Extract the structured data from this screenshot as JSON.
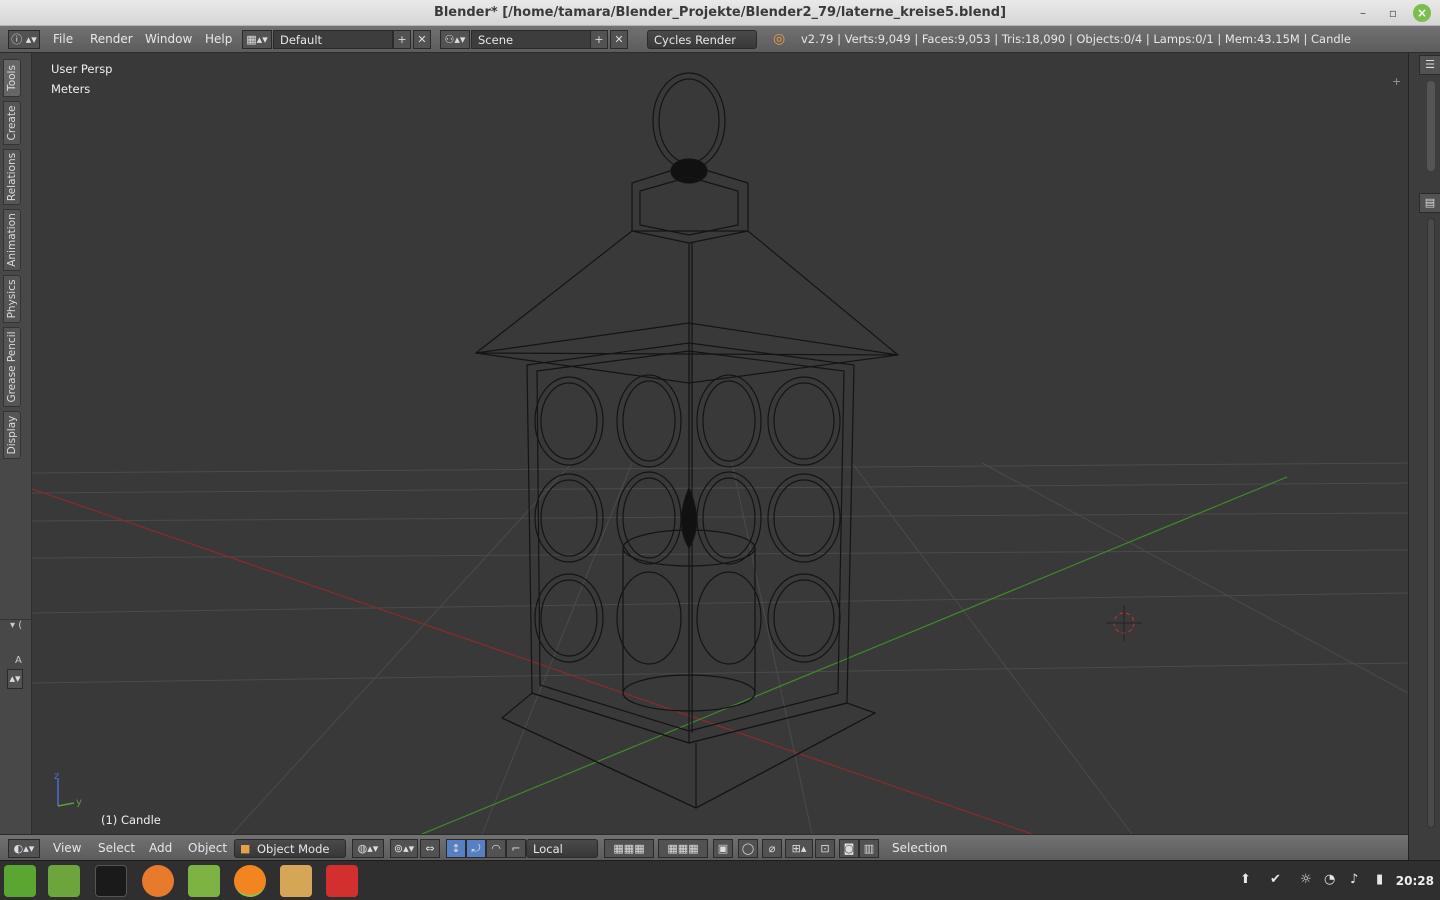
{
  "window": {
    "title": "Blender* [/home/tamara/Blender_Projekte/Blender2_79/laterne_kreise5.blend]",
    "minimize": "–",
    "maximize": "▫",
    "close": "×"
  },
  "info_header": {
    "menus": [
      "File",
      "Render",
      "Window",
      "Help"
    ],
    "screen_layout": "Default",
    "scene": "Scene",
    "render_engine": "Cycles Render",
    "stats": "v2.79 | Verts:9,049 | Faces:9,053 | Tris:18,090 | Objects:0/4 | Lamps:0/1 | Mem:43.15M | Candle"
  },
  "toolshelf": {
    "tabs": [
      "Tools",
      "Create",
      "Relations",
      "Animation",
      "Physics",
      "Grease Pencil",
      "Display"
    ],
    "operator_label": "A"
  },
  "viewport": {
    "view_name": "User Persp",
    "units": "Meters",
    "active_object": "(1) Candle",
    "axis_z": "z",
    "axis_y": "y",
    "colors": {
      "background": "#393939",
      "grid": "#4a4a4a",
      "x_axis": "#8a2b2b",
      "y_axis": "#3f8a2a",
      "wire": "#111111"
    }
  },
  "view3d_header": {
    "menus": [
      "View",
      "Select",
      "Add",
      "Object"
    ],
    "mode": "Object Mode",
    "pivot": "Local",
    "status": "Selection"
  },
  "taskbar": {
    "apps": [
      "mint-menu-icon",
      "files-icon",
      "terminal-icon",
      "firefox-icon",
      "folder-icon",
      "blender-icon",
      "archive-icon",
      "opera-icon"
    ],
    "clock": "20:28"
  }
}
